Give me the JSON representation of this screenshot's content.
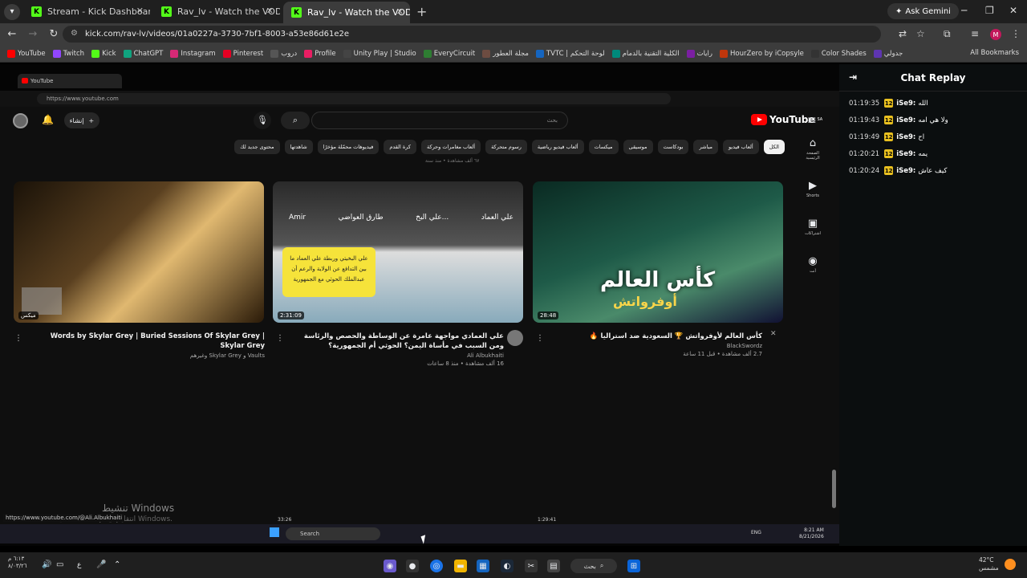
{
  "browser": {
    "tabs": [
      {
        "title": "Stream - Kick Dashboard",
        "active": false
      },
      {
        "title": "Rav_lv - Watch the VOD on Kick",
        "active": false
      },
      {
        "title": "Rav_lv - Watch the VOD on Kick",
        "active": true
      }
    ],
    "gemini_label": "Ask Gemini",
    "url": "kick.com/rav-lv/videos/01a0227a-3730-7bf1-8003-a53e86d61e2e",
    "bookmarks": [
      "YouTube",
      "Twitch",
      "Kick",
      "ChatGPT",
      "Instagram",
      "Pinterest",
      "دروب",
      "Profile",
      "Unity Play | Studio",
      "EveryCircuit",
      "مجلة العطور",
      "TVTC | لوحة التحكم",
      "الكلية التقنية بالدمام",
      "رايات",
      "HourZero by iCopsyle",
      "Color Shades",
      "جدولي"
    ],
    "all_bookmarks": "All Bookmarks"
  },
  "stream": {
    "inner_tab": "YouTube",
    "inner_url": "https://www.youtube.com",
    "youtube": {
      "logo": "YouTube",
      "logo_region": "SA",
      "search_placeholder": "بحث",
      "create_label": "إنشاء",
      "chips": [
        "الكل",
        "ألعاب فيديو",
        "مباشر",
        "بودكاست",
        "موسيقى",
        "ميكسات",
        "ألعاب فيديو رياضية",
        "رسوم متحركة",
        "ألعاب مغامرات وحركة",
        "كرة القدم",
        "فيديوهات محمّلة مؤخرًا",
        "شاهدتها",
        "محتوى جديد لك"
      ],
      "rail": [
        {
          "icon": "home",
          "label": "الصفحة الرئيسية"
        },
        {
          "icon": "shorts",
          "label": "Shorts"
        },
        {
          "icon": "subscriptions",
          "label": "اشتراكات"
        },
        {
          "icon": "you",
          "label": "أنت"
        }
      ],
      "stat_line": "٦٧ ألف مشاهدة • منذ سنة",
      "videos": [
        {
          "title": "Words by Skylar Grey | Buried Sessions Of Skylar Grey | Skylar Grey",
          "title_prefix": "ميكس",
          "sub": "Vaults و Skylar Grey وغيرهم",
          "thumb_label": "ميكس"
        },
        {
          "title": "علي العمادي مواجهة عامرة عن الوساطة والحصص والرئاسة ومن السبب في مأساة اليمن؟ الحوثي أم الجمهورية؟",
          "channel": "Ali Albukhaiti",
          "sub2": "16 ألف مشاهدة • منذ 8 ساعات",
          "duration": "2:31:09",
          "names": [
            "علي العماد",
            "علي البخ...",
            "طارق العواضي",
            "Amir"
          ],
          "card": "علي البخيتي وربطة علي العماد ما بين التدافع عن الولاية والرعم أن عبدالملك الحوثي مع الجمهورية"
        },
        {
          "title": "كأس العالم لأوفرواتش 🏆 السعودية ضد استراليا 🔥",
          "channel": "BlackSwordz",
          "sub2": "2.7 ألف مشاهدة • قبل 11 ساعة",
          "duration": "28:48",
          "thumb_title": "كأس العالم",
          "thumb_sub": "أوفرواتش"
        }
      ]
    },
    "status_url": "https://www.youtube.com/@Ali.Albukhaiti",
    "watermark": "تنشيط Windows",
    "watermark_sub": "انتقل إلى الإعدادات لتنشيط Windows.",
    "duration_left": "33:26",
    "duration_mid": "1:29:41",
    "inner_taskbar_search": "Search",
    "inner_lang": "ENG",
    "inner_time": "8:21 AM",
    "inner_date": "8/21/2026"
  },
  "chat": {
    "title": "Chat Replay",
    "messages": [
      {
        "time": "01:19:35",
        "badge": "12",
        "user": "iSe9:",
        "text": "الله"
      },
      {
        "time": "01:19:43",
        "badge": "12",
        "user": "iSe9:",
        "text": "ولا هي امه"
      },
      {
        "time": "01:19:49",
        "badge": "12",
        "user": "iSe9:",
        "text": "اح"
      },
      {
        "time": "01:20:21",
        "badge": "12",
        "user": "iSe9:",
        "text": "يمه"
      },
      {
        "time": "01:20:24",
        "badge": "12",
        "user": "iSe9:",
        "text": "كيف عاش"
      }
    ]
  },
  "taskbar": {
    "time": "٦:١٣ م",
    "date": "٨/٠٣/٢٦",
    "search": "بحث",
    "lang": "ع",
    "weather_temp": "42°C",
    "weather_desc": "مشمس"
  }
}
